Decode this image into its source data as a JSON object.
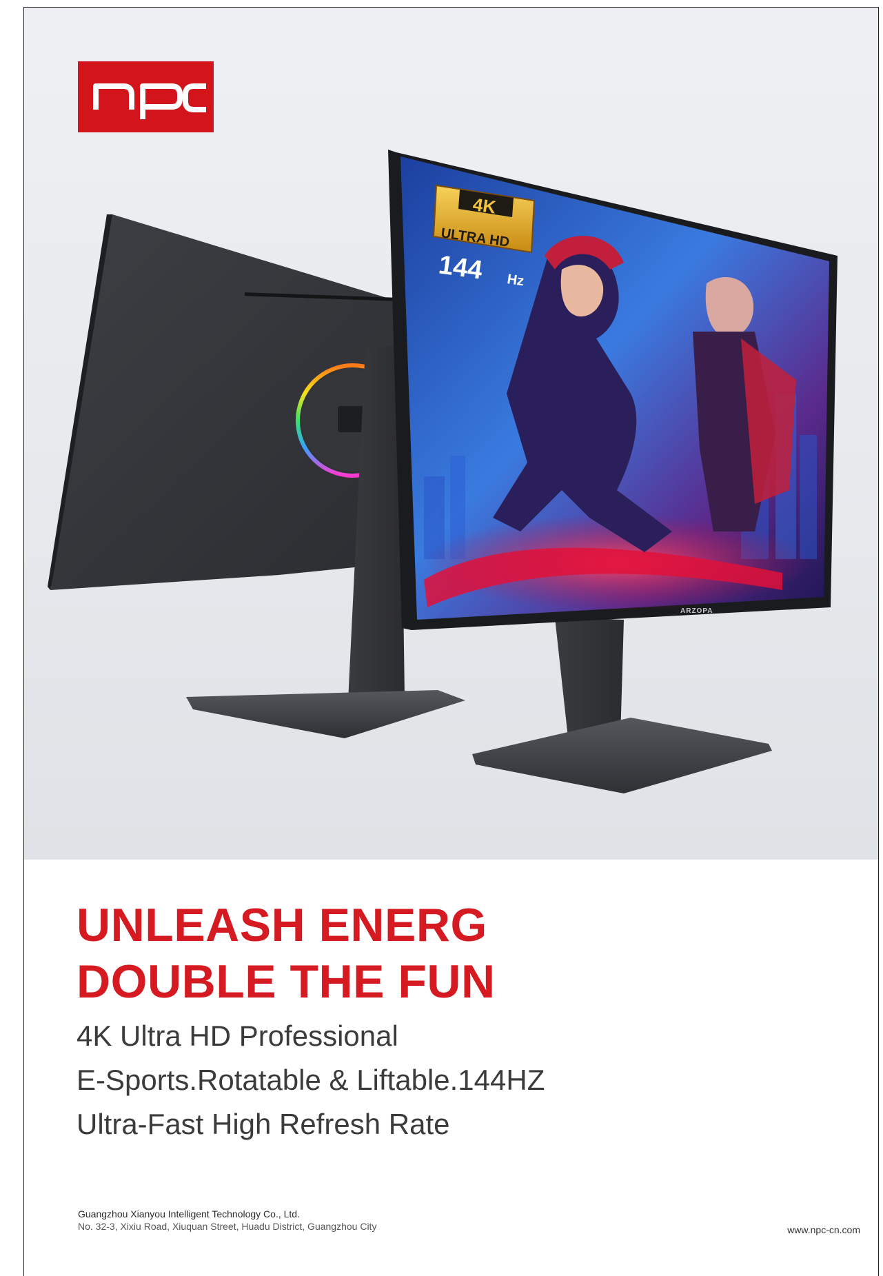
{
  "brand": {
    "logo_text": "npc",
    "accent_color": "#d4141b"
  },
  "hero": {
    "screen_badge": {
      "resolution": "4K",
      "resolution_label": "ULTRA HD",
      "refresh": "144",
      "refresh_unit": "Hz"
    },
    "monitor_brand": "ARZOPA"
  },
  "headline": {
    "line1": "UNLEASH ENERG",
    "line2": "DOUBLE THE FUN",
    "color": "#d51a22"
  },
  "subheadline": {
    "line1": "4K Ultra HD Professional",
    "line2": "E-Sports.Rotatable & Liftable.144HZ",
    "line3": "Ultra-Fast High Refresh Rate"
  },
  "footer": {
    "company": "Guangzhou Xianyou Intelligent Technology Co., Ltd.",
    "address": "No. 32-3, Xixiu Road, Xiuquan Street, Huadu District, Guangzhou City",
    "website": "www.npc-cn.com"
  }
}
